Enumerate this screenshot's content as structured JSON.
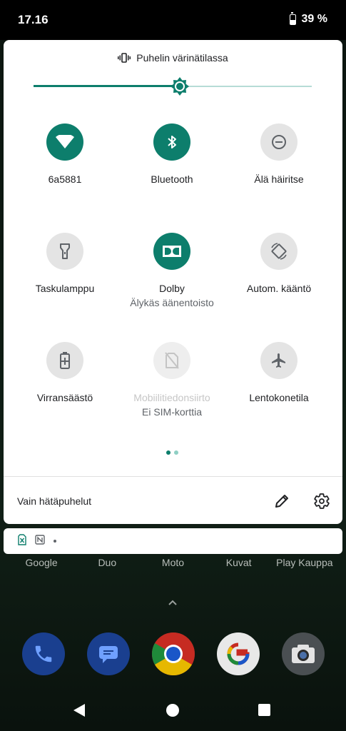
{
  "status": {
    "time": "17.16",
    "battery": "39 %",
    "battery_level": 0.39
  },
  "quick_settings": {
    "header": "Puhelin värinätilassa",
    "brightness_level": 0.52,
    "tiles": [
      {
        "label": "6a5881",
        "sub": "",
        "state": "on",
        "icon": "wifi-icon"
      },
      {
        "label": "Bluetooth",
        "sub": "",
        "state": "on",
        "icon": "bluetooth-icon"
      },
      {
        "label": "Älä häiritse",
        "sub": "",
        "state": "off",
        "icon": "do-not-disturb-icon"
      },
      {
        "label": "Taskulamppu",
        "sub": "",
        "state": "off",
        "icon": "flashlight-icon"
      },
      {
        "label": "Dolby",
        "sub": "Älykäs äänentoisto",
        "state": "on",
        "icon": "dolby-icon"
      },
      {
        "label": "Autom. kääntö",
        "sub": "",
        "state": "off",
        "icon": "auto-rotate-icon"
      },
      {
        "label": "Virransäästö",
        "sub": "",
        "state": "off",
        "icon": "battery-saver-icon"
      },
      {
        "label": "Mobiilitiedonsiirto",
        "sub": "Ei SIM-korttia",
        "state": "disabled",
        "icon": "mobile-data-icon"
      },
      {
        "label": "Lentokonetila",
        "sub": "",
        "state": "off",
        "icon": "airplane-icon"
      }
    ],
    "footer_text": "Vain hätäpuhelut"
  },
  "home": {
    "apps": [
      "Google",
      "Duo",
      "Moto",
      "Kuvat",
      "Play Kauppa"
    ],
    "dock": [
      "phone-icon",
      "messages-icon",
      "chrome-icon",
      "google-icon",
      "camera-icon"
    ]
  },
  "colors": {
    "accent": "#0d7e6c",
    "tile_off": "#e4e4e4"
  }
}
